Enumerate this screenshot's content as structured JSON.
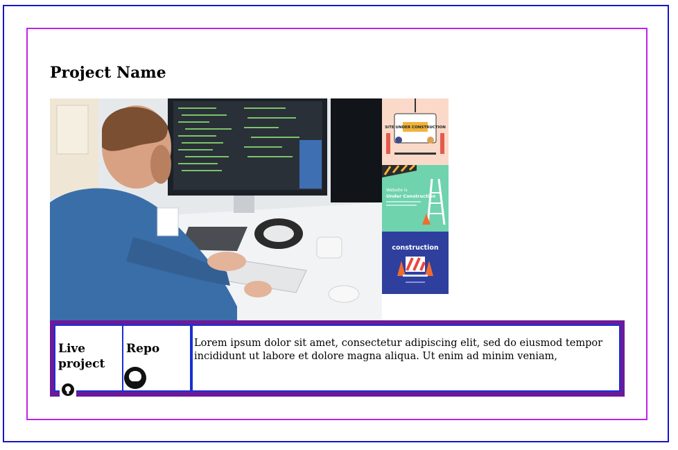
{
  "project": {
    "title": "Project Name"
  },
  "gallery": {
    "main_image": "developer-at-computer",
    "thumbnails": [
      "site-under-construction",
      "website-under-construction",
      "construction"
    ],
    "thumb_texts": {
      "first": "SITE UNDER CONSTRUCTION",
      "second_line1": "Website is",
      "second_line2": "Under Construction",
      "third": "construction"
    }
  },
  "links": {
    "live_label": "Live project",
    "repo_label": "Repo",
    "repo_icon": "github-icon"
  },
  "description": "Lorem ipsum dolor sit amet, consectetur adipiscing elit, sed do eiusmod tempor incididunt ut labore et dolore magna aliqua. Ut enim ad minim veniam,",
  "colors": {
    "outer_border": "#1515c8",
    "inner_border": "#c022e6",
    "strip_bg": "#6a1a9a",
    "cell_border": "#1a2fd0"
  }
}
